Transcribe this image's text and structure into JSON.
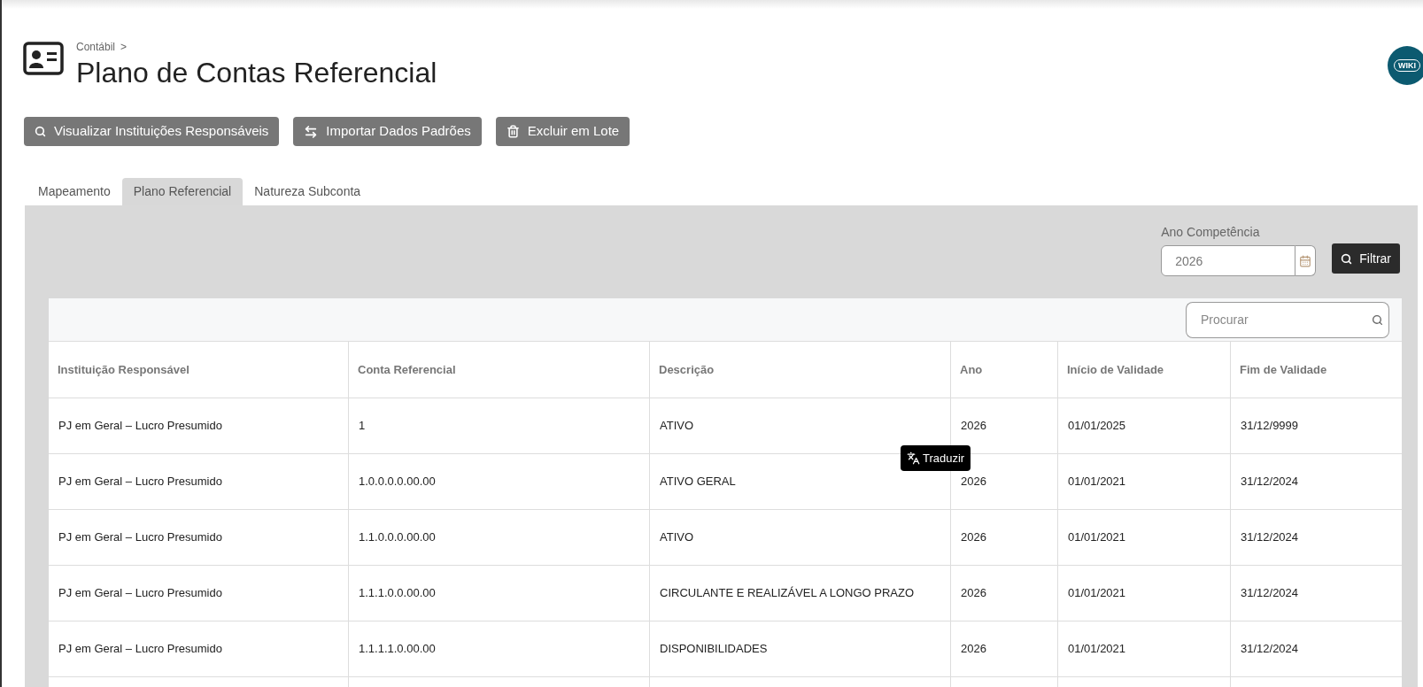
{
  "breadcrumb": {
    "items": [
      "Contábil"
    ],
    "separator": ">"
  },
  "title": "Plano de Contas Referencial",
  "wiki_badge": "WIKI",
  "actions": [
    {
      "label": "Visualizar Instituições Responsáveis",
      "kind": "search"
    },
    {
      "label": "Importar Dados Padrões",
      "kind": "swap"
    },
    {
      "label": "Excluir em Lote",
      "kind": "trash"
    }
  ],
  "tabs": [
    {
      "label": "Mapeamento",
      "selected": false
    },
    {
      "label": "Plano Referencial",
      "selected": true
    },
    {
      "label": "Natureza Subconta",
      "selected": false
    }
  ],
  "filter": {
    "label": "Ano Competência",
    "value": "2026",
    "button": "Filtrar"
  },
  "search": {
    "placeholder": "Procurar"
  },
  "table": {
    "columns": [
      "Instituição Responsável",
      "Conta Referencial",
      "Descrição",
      "Ano",
      "Início de Validade",
      "Fim de Validade"
    ],
    "rows": [
      [
        "PJ em Geral – Lucro Presumido",
        "1",
        "ATIVO",
        "2026",
        "01/01/2025",
        "31/12/9999"
      ],
      [
        "PJ em Geral – Lucro Presumido",
        "1.0.0.0.0.00.00",
        "ATIVO GERAL",
        "2026",
        "01/01/2021",
        "31/12/2024"
      ],
      [
        "PJ em Geral – Lucro Presumido",
        "1.1.0.0.0.00.00",
        "ATIVO",
        "2026",
        "01/01/2021",
        "31/12/2024"
      ],
      [
        "PJ em Geral – Lucro Presumido",
        "1.1.1.0.0.00.00",
        "CIRCULANTE E REALIZÁVEL A LONGO PRAZO",
        "2026",
        "01/01/2021",
        "31/12/2024"
      ],
      [
        "PJ em Geral – Lucro Presumido",
        "1.1.1.1.0.00.00",
        "DISPONIBILIDADES",
        "2026",
        "01/01/2021",
        "31/12/2024"
      ]
    ]
  },
  "tooltip": {
    "label": "Traduzir"
  }
}
